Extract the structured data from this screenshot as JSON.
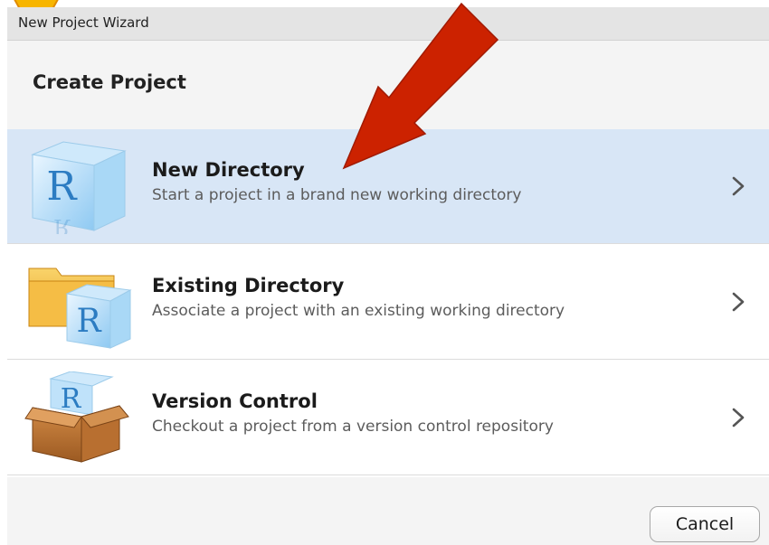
{
  "window": {
    "title": "New Project Wizard"
  },
  "header": {
    "title": "Create Project"
  },
  "options": [
    {
      "title": "New Directory",
      "description": "Start a project in a brand new working directory",
      "icon": "r-cube-icon",
      "selected": true
    },
    {
      "title": "Existing Directory",
      "description": "Associate a project with an existing working directory",
      "icon": "folder-r-icon",
      "selected": false
    },
    {
      "title": "Version Control",
      "description": "Checkout a project from a version control repository",
      "icon": "box-r-icon",
      "selected": false
    }
  ],
  "footer": {
    "cancel_label": "Cancel"
  },
  "annotation": {
    "arrow_color": "#cc2200",
    "icon": "red-arrow-icon"
  },
  "colors": {
    "selected_row": "#d8e6f6",
    "window_bg": "#f4f4f4",
    "r_letter": "#2c7cc2"
  }
}
